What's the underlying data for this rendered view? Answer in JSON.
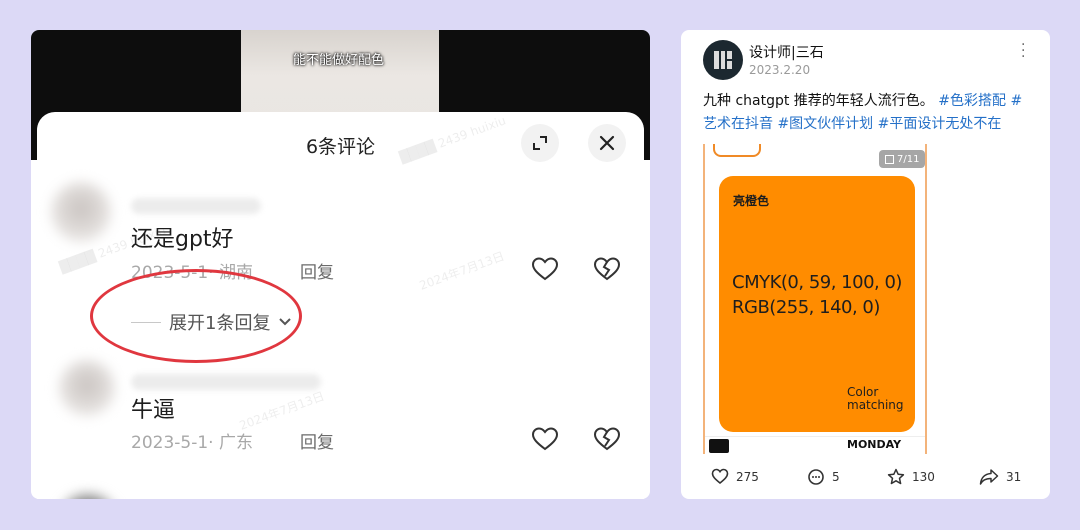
{
  "comments_panel": {
    "video_caption": "能不能做好配色",
    "title": "6条评论",
    "comments": [
      {
        "text": "还是gpt好",
        "meta": "2023-5-1· 湖南",
        "reply_label": "回复"
      },
      {
        "text": "牛逼",
        "meta": "2023-5-1· 广东",
        "reply_label": "回复"
      }
    ],
    "expand_replies_label": "展开1条回复"
  },
  "post": {
    "author": "设计师|三石",
    "date": "2023.2.20",
    "text": "九种 chatgpt 推荐的年轻人流行色。",
    "tags": [
      "#色彩搭配",
      "#艺术在抖音",
      "#图文伙伴计划",
      "#平面设计无处不在"
    ],
    "image": {
      "page_indicator": "7/11",
      "color_name": "亮橙色",
      "cmyk": "CMYK(0, 59, 100, 0)",
      "rgb": "RGB(255, 140, 0)",
      "caption": "Color matching",
      "footer_day": "MONDAY",
      "card_color": "#ff8c00"
    },
    "stats": {
      "likes": "275",
      "comments": "5",
      "favorites": "130",
      "shares": "31"
    }
  },
  "colors": {
    "background": "#dcd9f6",
    "highlight_ellipse": "#e0373f",
    "tag_blue": "#2470c8"
  }
}
